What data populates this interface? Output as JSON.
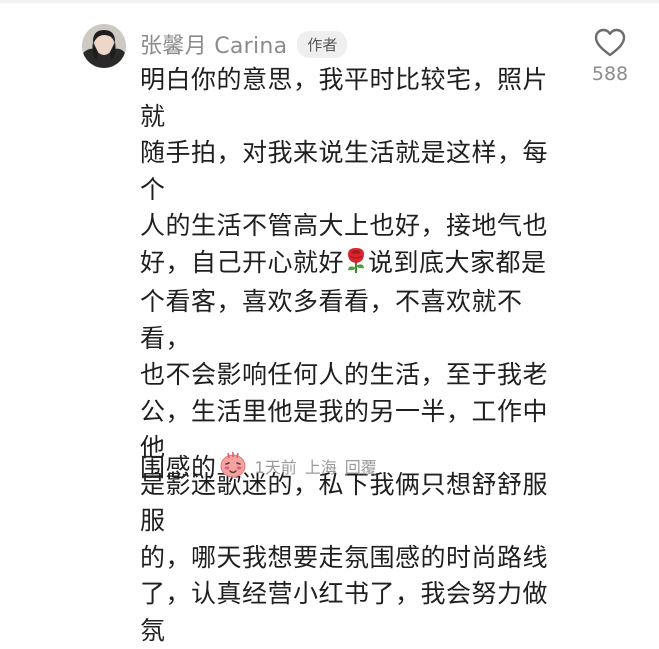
{
  "comment": {
    "author": "张馨月 Carina",
    "author_badge": "作者",
    "body_part1": "明白你的意思，我平时比较宅，照片就\n随手拍，对我来说生活就是这样，每个\n人的生活不管高大上也好，接地气也\n好，自己开心就好",
    "body_part2": "说到底大家都是\n个看客，喜欢多看看，不喜欢就不看，\n也不会影响任何人的生活，至于我老\n公，生活里他是我的另一半，工作中他\n是影迷歌迷的，私下我俩只想舒舒服服\n的，哪天我想要走氛围感的时尚路线\n了，认真经营小红书了，我会努力做氛",
    "body_tail": "围感的",
    "time": "1天前",
    "location": "上海",
    "reply_label": "回覆"
  },
  "like": {
    "count": "588",
    "icon": "heart-outline-icon"
  },
  "emojis": [
    "rose-emoji",
    "blushing-face-emoji"
  ],
  "colors": {
    "text": "#1f1f1f",
    "muted": "#8c8c8c",
    "meta": "#9b9b9b",
    "badge_bg": "#efefef"
  }
}
